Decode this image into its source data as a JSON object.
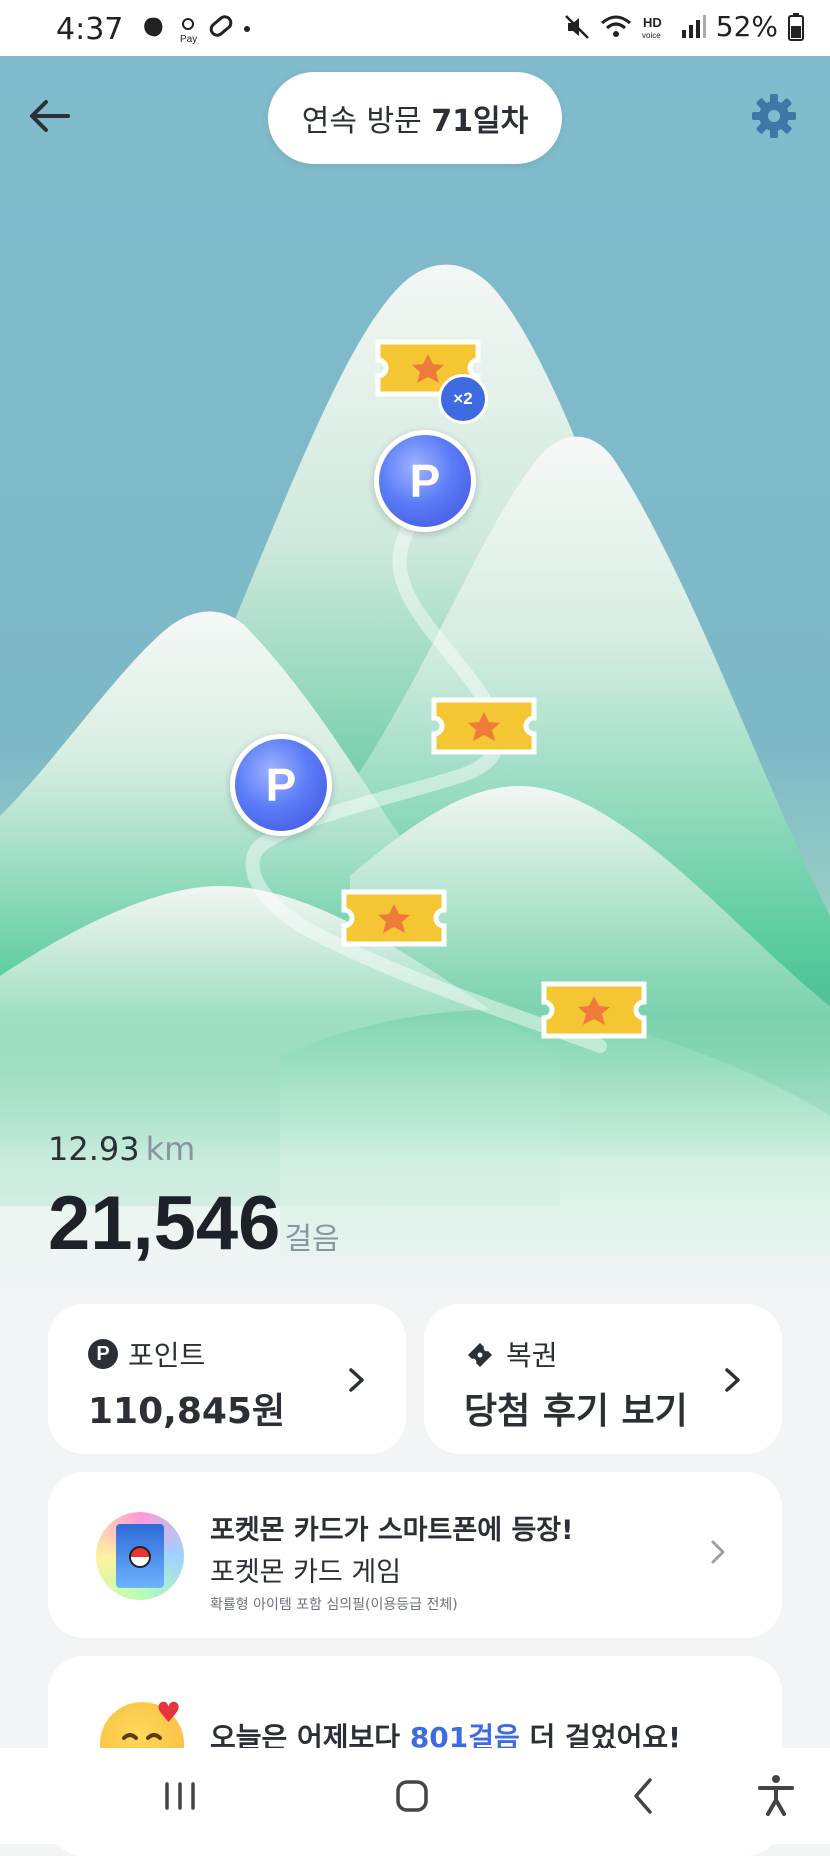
{
  "status_bar": {
    "time": "4:37",
    "battery": "52%"
  },
  "header": {
    "visit_prefix": "연속 방문 ",
    "visit_days": "71일차"
  },
  "rewards": {
    "multiplier": "×2",
    "coin_letter": "P"
  },
  "stats": {
    "distance_value": "12.93",
    "distance_unit": "km",
    "steps_value": "21,546",
    "steps_unit": "걸음"
  },
  "cards": {
    "points_label": "포인트",
    "points_value": "110,845원",
    "points_icon_letter": "P",
    "lotto_label": "복권",
    "lotto_value": "당첨 후기 보기"
  },
  "promo": {
    "title": "포켓몬 카드가 스마트폰에 등장!",
    "subtitle": "포켓몬 카드 게임",
    "note": "확률형 아이템 포함 심의필(이용등급 전체)"
  },
  "compare": {
    "text_before": "오늘은 어제보다 ",
    "highlight": "801걸음",
    "text_after": " 더 걸었어요!"
  },
  "colors": {
    "sky": "#80bccd",
    "mountain": "#4fc79a",
    "coin": "#5b7cf7",
    "ticket": "#f5c634",
    "highlight": "#3f6be0"
  }
}
